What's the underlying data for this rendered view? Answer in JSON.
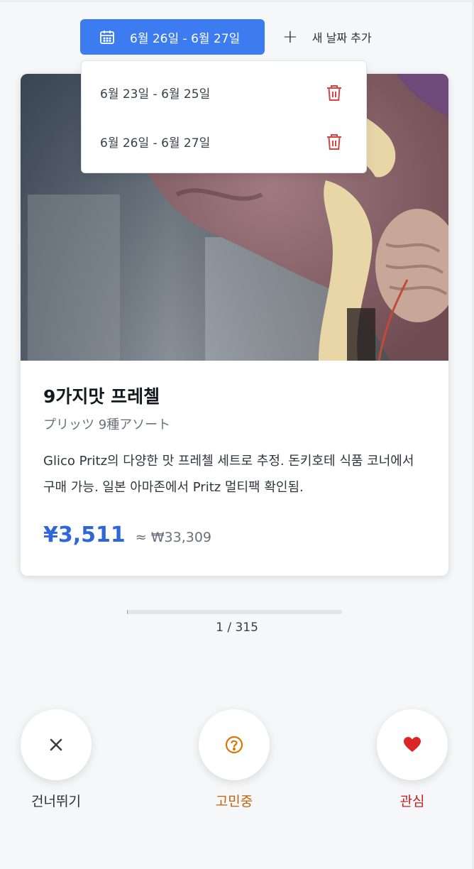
{
  "date_selector": {
    "current_range": "6월 26일 - 6월 27일",
    "add_label": "새 날짜 추가",
    "options": [
      {
        "label": "6월 23일 - 6월 25일"
      },
      {
        "label": "6월 26일 - 6월 27일"
      }
    ]
  },
  "product": {
    "title": "9가지맛 프레첼",
    "subtitle": "プリッツ 9種アソート",
    "description": "Glico Pritz의 다양한 맛 프레첼 세트로 추정. 돈키호테 식품 코너에서 구매 가능. 일본 아마존에서 Pritz 멀티팩 확인됨.",
    "price_jpy": "¥3,511",
    "price_krw": "≈ ₩33,309"
  },
  "progress": {
    "counter": "1 / 315",
    "fraction": 0.0032
  },
  "actions": {
    "skip_label": "건너뛰기",
    "maybe_label": "고민중",
    "like_label": "관심"
  },
  "colors": {
    "accent": "#3d7cf0",
    "price": "#2f67d8",
    "skip": "#2b2f36",
    "maybe": "#d97706",
    "like": "#dc2626",
    "trash": "#d64545"
  },
  "icons": {
    "date": "calendar-icon",
    "add": "plus-icon",
    "delete": "trash-icon",
    "skip": "close-icon",
    "maybe": "question-circle-icon",
    "like": "heart-icon"
  }
}
